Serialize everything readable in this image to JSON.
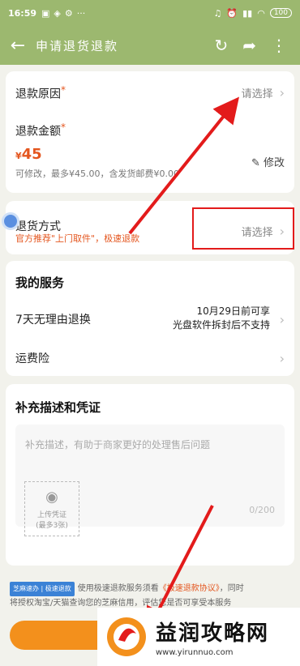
{
  "status_bar": {
    "time": "16:59",
    "battery": "100"
  },
  "header": {
    "back_icon": "back-arrow-icon",
    "title": "申请退货退款"
  },
  "refund_reason": {
    "label": "退款原因",
    "required_mark": "*",
    "value_hint": "请选择"
  },
  "refund_amount": {
    "label": "退款金额",
    "required_mark": "*",
    "currency": "¥",
    "amount": "45",
    "note": "可修改，最多¥45.00，含发货邮费¥0.00",
    "edit_label": "修改"
  },
  "return_method": {
    "label": "退货方式",
    "recommendation": "官方推荐\"上门取件\"，极速退款",
    "value_hint": "请选择"
  },
  "services": {
    "title": "我的服务",
    "items": [
      {
        "label": "7天无理由退换",
        "line1": "10月29日前可享",
        "line2": "光盘软件拆封后不支持"
      },
      {
        "label": "运费险"
      }
    ]
  },
  "evidence": {
    "title": "补充描述和凭证",
    "placeholder": "补充描述，有助于商家更好的处理售后问题",
    "counter": "0/200",
    "upload_label": "上传凭证",
    "upload_limit": "(最多3张)"
  },
  "agreement": {
    "badge_left": "芝麻速办",
    "badge_right": "极速退款",
    "text_before": "使用极速退款服务须",
    "text_before_tail": "看",
    "link": "《极速退款协议》",
    "text_after": "，同时",
    "line2": "将授权淘宝/天猫查询您的芝麻信用",
    "line2_tail": "，评估您是否可享受本服务"
  },
  "watermark": {
    "name": "益润攻略网",
    "url": "www.yirunnuo.com"
  },
  "colors": {
    "header_green": "#9cb86f",
    "accent_orange": "#e4561f",
    "submit_orange": "#f3901c",
    "annotation_red": "#e31b1b"
  }
}
